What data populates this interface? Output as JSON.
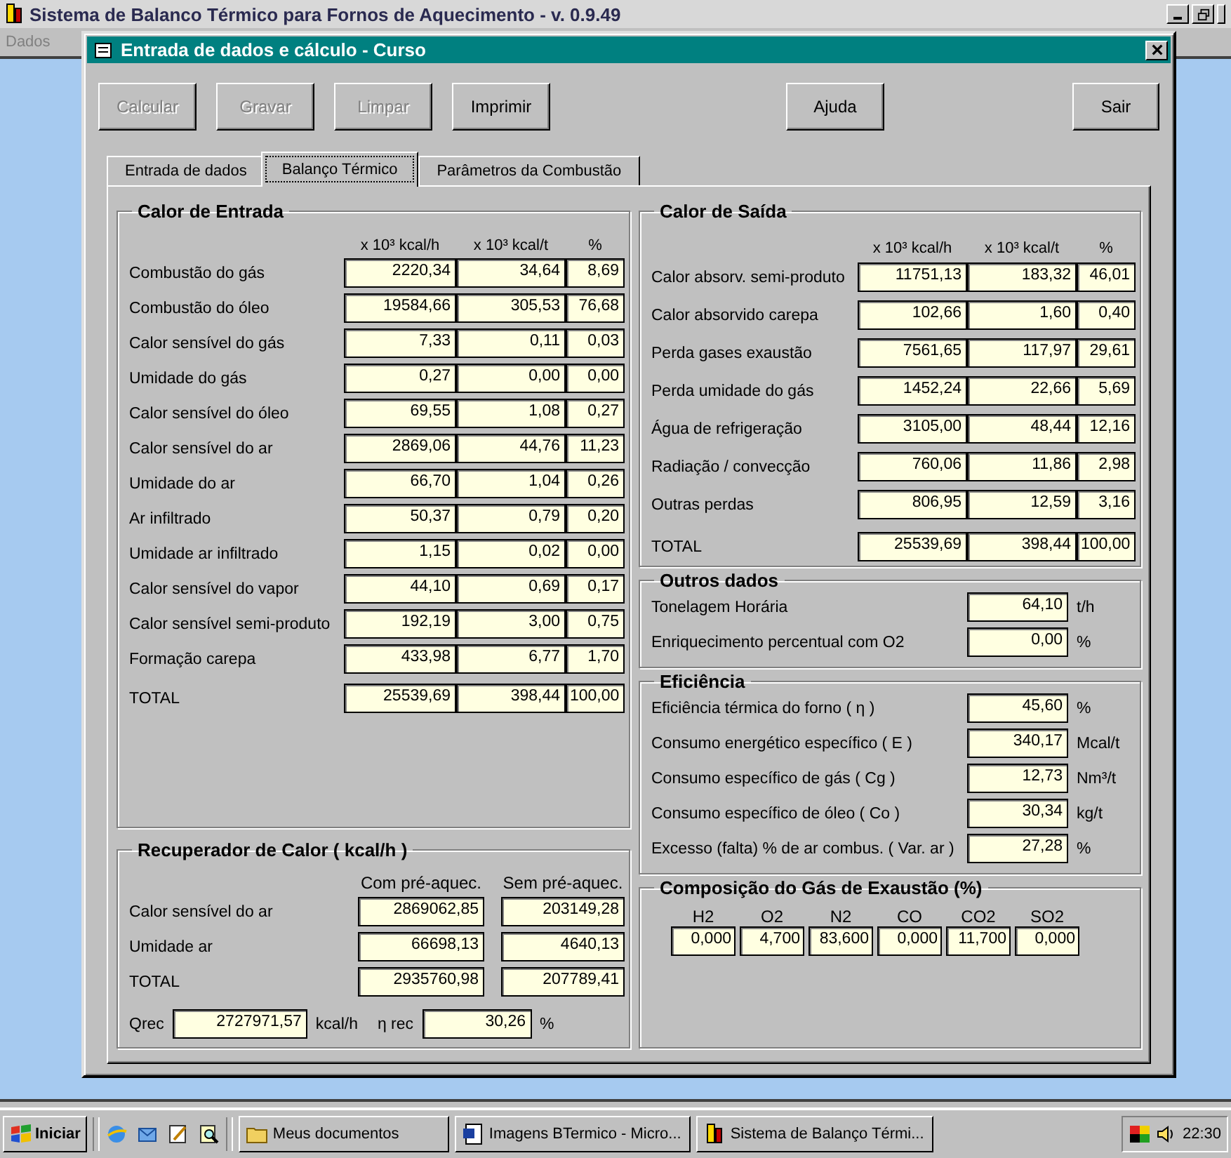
{
  "app_window": {
    "title": "Sistema de Balanco Térmico para Fornos de Aquecimento - v. 0.9.49",
    "menu": [
      "Dados"
    ]
  },
  "dialog": {
    "title": "Entrada de dados e cálculo - Curso",
    "buttons": [
      {
        "label": "Calcular",
        "disabled": true,
        "kind": "left"
      },
      {
        "label": "Gravar",
        "disabled": true,
        "kind": "left"
      },
      {
        "label": "Limpar",
        "disabled": true,
        "kind": "left"
      },
      {
        "label": "Imprimir",
        "disabled": false,
        "kind": "left"
      },
      {
        "label": "Ajuda",
        "disabled": false,
        "kind": "middle"
      },
      {
        "label": "Sair",
        "disabled": false,
        "kind": "right"
      }
    ],
    "tabs": [
      {
        "label": "Entrada de dados",
        "selected": false
      },
      {
        "label": "Balanço Térmico",
        "selected": true
      },
      {
        "label": "Parâmetros da Combustão",
        "selected": false
      }
    ],
    "calor_entrada": {
      "title": "Calor de Entrada",
      "columns": [
        "x 10³ kcal/h",
        "x 10³ kcal/t",
        "%"
      ],
      "rows": [
        {
          "label": "Combustão do gás",
          "values": [
            "2220,34",
            "34,64",
            "8,69"
          ]
        },
        {
          "label": "Combustão do óleo",
          "values": [
            "19584,66",
            "305,53",
            "76,68"
          ]
        },
        {
          "label": "Calor sensível do gás",
          "values": [
            "7,33",
            "0,11",
            "0,03"
          ]
        },
        {
          "label": "Umidade do gás",
          "values": [
            "0,27",
            "0,00",
            "0,00"
          ]
        },
        {
          "label": "Calor sensível do óleo",
          "values": [
            "69,55",
            "1,08",
            "0,27"
          ]
        },
        {
          "label": "Calor sensível do ar",
          "values": [
            "2869,06",
            "44,76",
            "11,23"
          ]
        },
        {
          "label": "Umidade do ar",
          "values": [
            "66,70",
            "1,04",
            "0,26"
          ]
        },
        {
          "label": "Ar infiltrado",
          "values": [
            "50,37",
            "0,79",
            "0,20"
          ]
        },
        {
          "label": "Umidade ar infiltrado",
          "values": [
            "1,15",
            "0,02",
            "0,00"
          ]
        },
        {
          "label": "Calor sensível do vapor",
          "values": [
            "44,10",
            "0,69",
            "0,17"
          ]
        },
        {
          "label": "Calor sensível semi-produto",
          "values": [
            "192,19",
            "3,00",
            "0,75"
          ]
        },
        {
          "label": "Formação carepa",
          "values": [
            "433,98",
            "6,77",
            "1,70"
          ]
        }
      ],
      "total": {
        "label": "TOTAL",
        "values": [
          "25539,69",
          "398,44",
          "100,00"
        ]
      }
    },
    "recuperador": {
      "title": "Recuperador de Calor ( kcal/h )",
      "columns": [
        "Com pré-aquec.",
        "Sem pré-aquec."
      ],
      "rows": [
        {
          "label": "Calor sensível do ar",
          "values": [
            "2869062,85",
            "203149,28"
          ]
        },
        {
          "label": "Umidade ar",
          "values": [
            "66698,13",
            "4640,13"
          ]
        },
        {
          "label": "TOTAL",
          "values": [
            "2935760,98",
            "207789,41"
          ]
        }
      ],
      "qrec": {
        "label": "Qrec",
        "value": "2727971,57",
        "unit": "kcal/h"
      },
      "eta_rec": {
        "label": "η rec",
        "value": "30,26",
        "unit": "%"
      }
    },
    "calor_saida": {
      "title": "Calor de Saída",
      "columns": [
        "x 10³ kcal/h",
        "x 10³ kcal/t",
        "%"
      ],
      "rows": [
        {
          "label": "Calor absorv. semi-produto",
          "values": [
            "11751,13",
            "183,32",
            "46,01"
          ]
        },
        {
          "label": "Calor absorvido carepa",
          "values": [
            "102,66",
            "1,60",
            "0,40"
          ]
        },
        {
          "label": "Perda gases exaustão",
          "values": [
            "7561,65",
            "117,97",
            "29,61"
          ]
        },
        {
          "label": "Perda umidade do gás",
          "values": [
            "1452,24",
            "22,66",
            "5,69"
          ]
        },
        {
          "label": "Água de refrigeração",
          "values": [
            "3105,00",
            "48,44",
            "12,16"
          ]
        },
        {
          "label": "Radiação / convecção",
          "values": [
            "760,06",
            "11,86",
            "2,98"
          ]
        },
        {
          "label": "Outras perdas",
          "values": [
            "806,95",
            "12,59",
            "3,16"
          ]
        }
      ],
      "total": {
        "label": "TOTAL",
        "values": [
          "25539,69",
          "398,44",
          "100,00"
        ]
      }
    },
    "outros_dados": {
      "title": "Outros dados",
      "rows": [
        {
          "label": "Tonelagem Horária",
          "value": "64,10",
          "unit": "t/h"
        },
        {
          "label": "Enriquecimento percentual com O2",
          "value": "0,00",
          "unit": "%"
        }
      ]
    },
    "eficiencia": {
      "title": "Eficiência",
      "rows": [
        {
          "label": "Eficiência térmica do forno ( η )",
          "value": "45,60",
          "unit": "%"
        },
        {
          "label": "Consumo energético específico ( E )",
          "value": "340,17",
          "unit": "Mcal/t"
        },
        {
          "label": "Consumo específico de gás ( Cg )",
          "value": "12,73",
          "unit": "Nm³/t"
        },
        {
          "label": "Consumo específico de óleo ( Co )",
          "value": "30,34",
          "unit": "kg/t"
        },
        {
          "label": "Excesso (falta) % de ar combus. ( Var. ar )",
          "value": "27,28",
          "unit": "%"
        }
      ]
    },
    "composicao": {
      "title": "Composição do Gás de Exaustão (%)",
      "items": [
        {
          "label": "H2",
          "value": "0,000"
        },
        {
          "label": "O2",
          "value": "4,700"
        },
        {
          "label": "N2",
          "value": "83,600"
        },
        {
          "label": "CO",
          "value": "0,000"
        },
        {
          "label": "CO2",
          "value": "11,700"
        },
        {
          "label": "SO2",
          "value": "0,000"
        }
      ]
    }
  },
  "taskbar": {
    "start": "Iniciar",
    "tasks": [
      {
        "label": "Meus documentos",
        "kind": "folder"
      },
      {
        "label": "Imagens BTermico - Micro...",
        "kind": "document"
      },
      {
        "label": "Sistema de Balanço Térmi...",
        "kind": "app"
      }
    ],
    "clock": "22:30"
  }
}
